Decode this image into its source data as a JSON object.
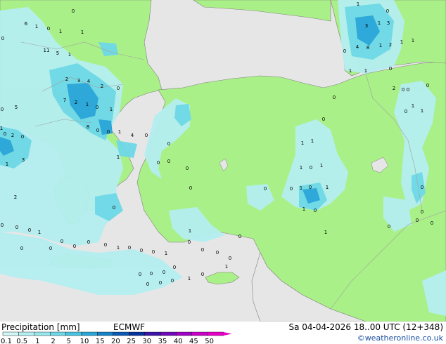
{
  "header": {
    "product_title": "Precipitation [mm]",
    "model": "ECMWF",
    "valid_time": "Sa 04-04-2026 18..00 UTC (12+348)",
    "credit": "©weatheronline.co.uk"
  },
  "legend": {
    "labels": [
      "0.1",
      "0.5",
      "1",
      "2",
      "5",
      "10",
      "15",
      "20",
      "25",
      "30",
      "35",
      "40",
      "45",
      "50"
    ],
    "colors": [
      "#d2f5f5",
      "#b4eef0",
      "#96e6eb",
      "#6ed8e6",
      "#46c4e0",
      "#2aa6d8",
      "#1582c8",
      "#0a5ab4",
      "#05329b",
      "#3c14aa",
      "#6e0ab9",
      "#a000c8",
      "#c800c8",
      "#e600c8"
    ]
  },
  "map_colors": {
    "land": "#aaf088",
    "no_model_land": "#e6e6e6",
    "sea": "#e6e6e6",
    "border": "#a0a0a0",
    "coast": "#808080"
  },
  "map_labels": [
    {
      "text": "6"
    },
    {
      "text": "1"
    },
    {
      "text": "0"
    },
    {
      "text": "1"
    },
    {
      "text": "0"
    },
    {
      "text": "1"
    },
    {
      "text": "11"
    },
    {
      "text": "5"
    },
    {
      "text": "1"
    },
    {
      "text": "0"
    },
    {
      "text": "2"
    },
    {
      "text": "3"
    },
    {
      "text": "4"
    },
    {
      "text": "7"
    },
    {
      "text": "2"
    },
    {
      "text": "1"
    },
    {
      "text": "0"
    },
    {
      "text": "1"
    },
    {
      "text": "2"
    },
    {
      "text": "5"
    },
    {
      "text": "8"
    },
    {
      "text": "0"
    },
    {
      "text": "0"
    },
    {
      "text": "1"
    },
    {
      "text": "0"
    },
    {
      "text": "0"
    },
    {
      "text": "2"
    },
    {
      "text": "0"
    },
    {
      "text": "1"
    },
    {
      "text": "3"
    },
    {
      "text": "1"
    },
    {
      "text": "0"
    },
    {
      "text": "1"
    },
    {
      "text": "4"
    },
    {
      "text": "0"
    },
    {
      "text": "2"
    },
    {
      "text": "0"
    },
    {
      "text": "0"
    },
    {
      "text": "0"
    },
    {
      "text": "1"
    },
    {
      "text": "0"
    },
    {
      "text": "0"
    },
    {
      "text": "0"
    },
    {
      "text": "0"
    },
    {
      "text": "0"
    },
    {
      "text": "0"
    },
    {
      "text": "1"
    },
    {
      "text": "0"
    },
    {
      "text": "0"
    },
    {
      "text": "0"
    },
    {
      "text": "1"
    },
    {
      "text": "0"
    },
    {
      "text": "0"
    },
    {
      "text": "0"
    },
    {
      "text": "0"
    },
    {
      "text": "1"
    },
    {
      "text": "3"
    },
    {
      "text": "1"
    },
    {
      "text": "3"
    },
    {
      "text": "0"
    },
    {
      "text": "4"
    },
    {
      "text": "8"
    },
    {
      "text": "1"
    },
    {
      "text": "2"
    },
    {
      "text": "1"
    },
    {
      "text": "1"
    },
    {
      "text": "1"
    },
    {
      "text": "1"
    },
    {
      "text": "0"
    },
    {
      "text": "0"
    },
    {
      "text": "0"
    },
    {
      "text": "0"
    },
    {
      "text": "0"
    },
    {
      "text": "1"
    },
    {
      "text": "0"
    },
    {
      "text": "1"
    },
    {
      "text": "2"
    },
    {
      "text": "0"
    },
    {
      "text": "0"
    },
    {
      "text": "1"
    },
    {
      "text": "1"
    },
    {
      "text": "1"
    },
    {
      "text": "1"
    },
    {
      "text": "0"
    },
    {
      "text": "0"
    },
    {
      "text": "1"
    },
    {
      "text": "0"
    },
    {
      "text": "1"
    },
    {
      "text": "0"
    },
    {
      "text": "1"
    },
    {
      "text": "0"
    },
    {
      "text": "1"
    },
    {
      "text": "0"
    },
    {
      "text": "0"
    },
    {
      "text": "0"
    },
    {
      "text": "0"
    },
    {
      "text": "0"
    },
    {
      "text": "0"
    },
    {
      "text": "0"
    },
    {
      "text": "0"
    },
    {
      "text": "0"
    },
    {
      "text": "0"
    },
    {
      "text": "1"
    },
    {
      "text": "0"
    },
    {
      "text": "0"
    },
    {
      "text": "0"
    },
    {
      "text": "0"
    },
    {
      "text": "0"
    },
    {
      "text": "1"
    },
    {
      "text": "0"
    },
    {
      "text": "1"
    },
    {
      "text": "0"
    },
    {
      "text": "0"
    },
    {
      "text": "0"
    },
    {
      "text": "0"
    }
  ]
}
